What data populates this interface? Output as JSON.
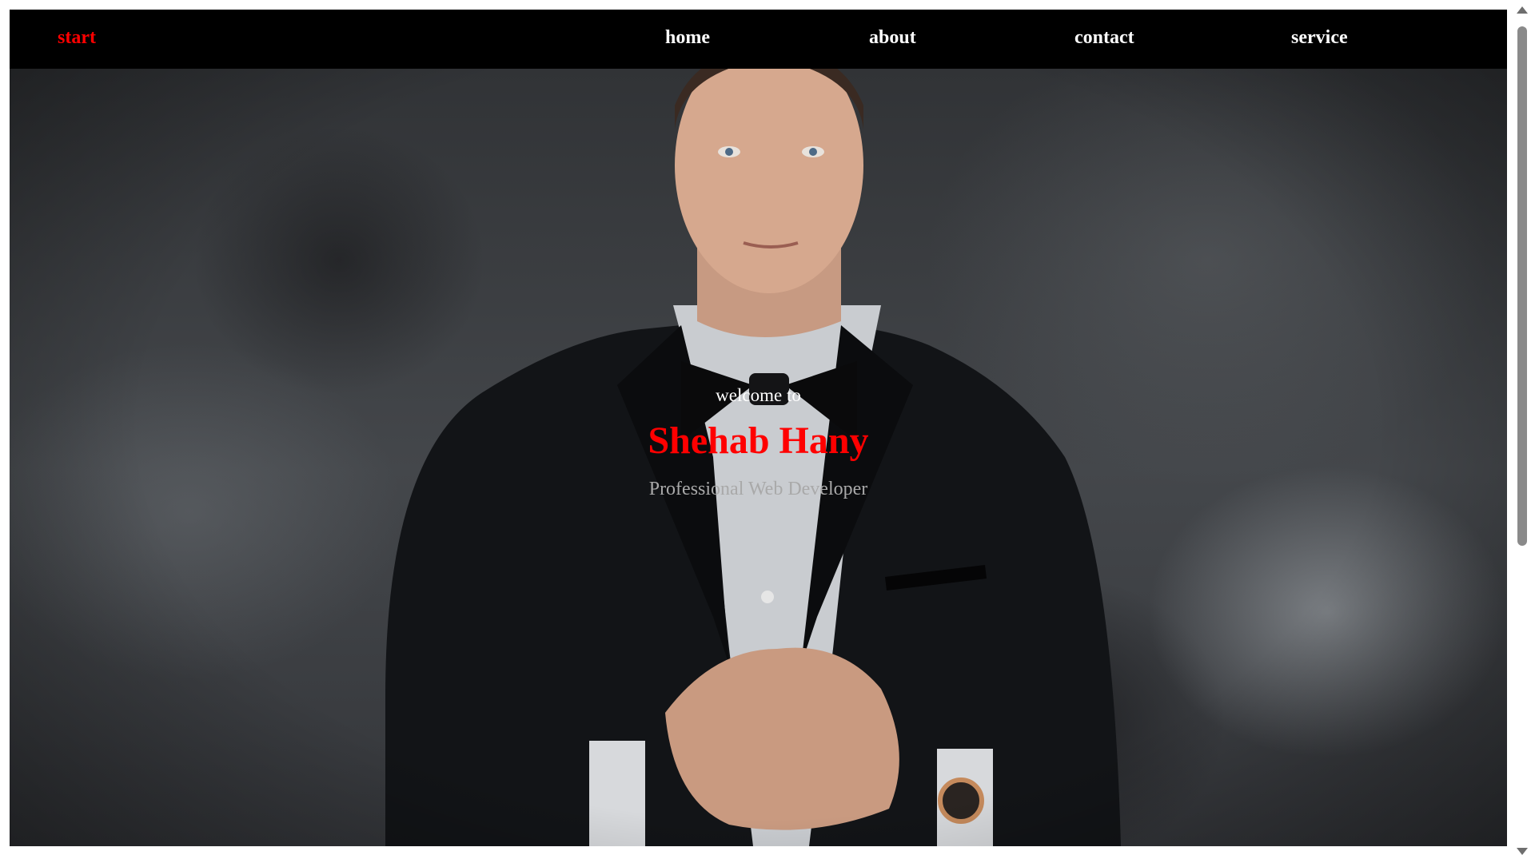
{
  "nav": {
    "brand": "start",
    "links": [
      "home",
      "about",
      "contact",
      "service"
    ]
  },
  "hero": {
    "welcome": "welcome to",
    "name": "Shehab Hany",
    "role": "Professional Web Developer"
  },
  "colors": {
    "accent": "#ff0000",
    "navbar_bg": "#000000",
    "nav_text": "#ffffff",
    "role_text": "#a9a9a9"
  }
}
